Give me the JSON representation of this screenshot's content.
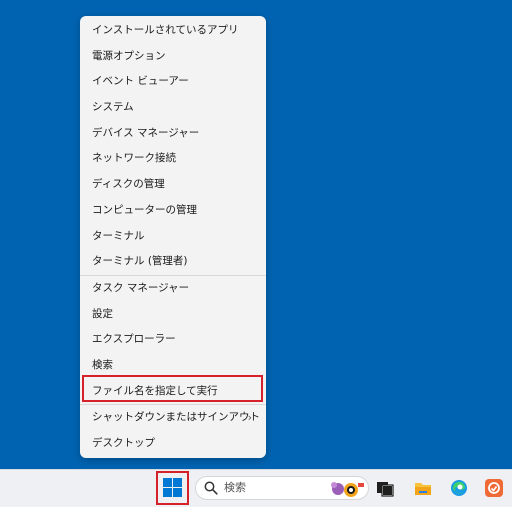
{
  "menu": {
    "items_group1": [
      {
        "label": "インストールされているアプリ"
      },
      {
        "label": "電源オプション"
      },
      {
        "label": "イベント ビューアー"
      },
      {
        "label": "システム"
      },
      {
        "label": "デバイス マネージャー"
      },
      {
        "label": "ネットワーク接続"
      },
      {
        "label": "ディスクの管理"
      },
      {
        "label": "コンピューターの管理"
      },
      {
        "label": "ターミナル"
      },
      {
        "label": "ターミナル (管理者)"
      }
    ],
    "items_group2": [
      {
        "label": "タスク マネージャー"
      },
      {
        "label": "設定"
      },
      {
        "label": "エクスプローラー"
      },
      {
        "label": "検索"
      },
      {
        "label": "ファイル名を指定して実行"
      }
    ],
    "items_group3": [
      {
        "label": "シャットダウンまたはサインアウト",
        "chevron": "›"
      },
      {
        "label": "デスクトップ"
      }
    ]
  },
  "taskbar": {
    "search_placeholder": "検索"
  },
  "colors": {
    "desktop": "#0063b1",
    "highlight": "#d6202a",
    "menu_bg": "#f3f3f3"
  }
}
